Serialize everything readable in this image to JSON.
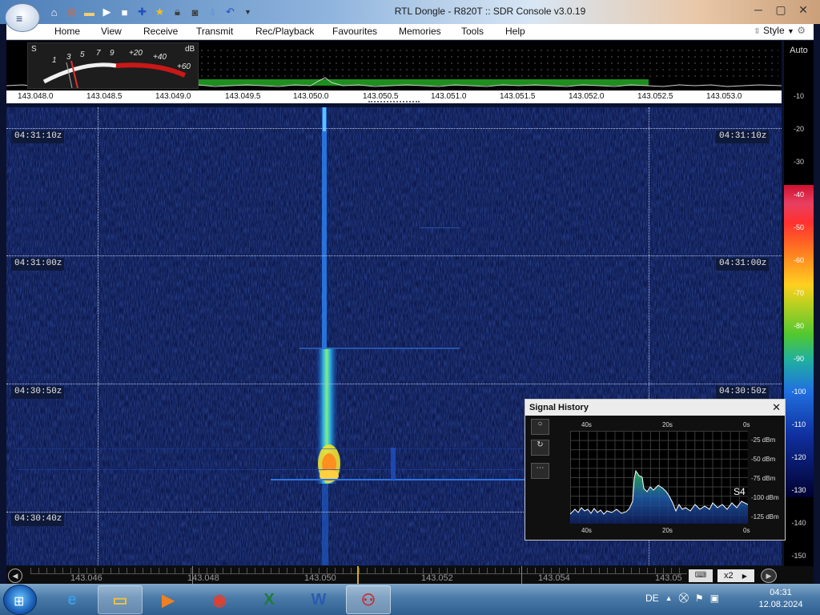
{
  "window": {
    "title": "RTL Dongle - R820T :: SDR Console v3.0.19",
    "minimize_glyph": "─",
    "maximize_glyph": "▢",
    "close_glyph": "✕",
    "orb_icon": "≡"
  },
  "quick_access": [
    "home-icon",
    "lifebuoy-icon",
    "folder-icon",
    "play-icon",
    "stop-icon",
    "plus-icon",
    "star-icon",
    "lock-icon",
    "camera-icon",
    "drop-icon",
    "undo-icon",
    "dropdown-icon"
  ],
  "menu": {
    "items": [
      "Home",
      "View",
      "Receive",
      "Transmit",
      "Rec/Playback",
      "Favourites",
      "Memories",
      "Tools",
      "Help"
    ],
    "style_label": "Style"
  },
  "smeter": {
    "s_label": "S",
    "db_label": "dB",
    "scale": [
      "1",
      "3",
      "5",
      "7",
      "9",
      "+20",
      "+40",
      "+60"
    ]
  },
  "freq_axis": {
    "ticks": [
      "143.048.0",
      "143.048.5",
      "143.049.0",
      "143.049.5",
      "143.050.0",
      "143.050.5",
      "143.051.0",
      "143.051.5",
      "143.052.0",
      "143.052.5",
      "143.053.0"
    ]
  },
  "waterfall": {
    "timestamps": [
      "04:31:10z",
      "04:31:00z",
      "04:30:50z",
      "04:30:40z"
    ]
  },
  "level_scale": {
    "auto_label": "Auto",
    "gray_levels": [
      "-10",
      "-20",
      "-30"
    ],
    "color_levels": [
      "-40",
      "-50",
      "-60",
      "-70",
      "-80",
      "-90",
      "-100",
      "-110",
      "-120",
      "-130"
    ],
    "bottom_levels": [
      "-140",
      "-150"
    ]
  },
  "bottom_bar": {
    "ticks": [
      "143.046",
      "143.048",
      "143.050",
      "143.052",
      "143.054",
      "143.05"
    ],
    "zoom_label": "x2"
  },
  "signal_history": {
    "title": "Signal History",
    "close_glyph": "✕",
    "time_labels": [
      "40s",
      "20s",
      "0s"
    ],
    "dbm_labels": [
      "-25 dBm",
      "-50 dBm",
      "-75 dBm",
      "-100 dBm",
      "-125 dBm"
    ],
    "s_reading": "S4",
    "button_glyphs": [
      "○",
      "↻",
      "⋯"
    ]
  },
  "taskbar": {
    "start_glyph": "⊞",
    "language": "DE",
    "time": "04:31",
    "date": "12.08.2024",
    "apps": [
      {
        "name": "ie",
        "glyph": "e",
        "color": "#3a9bea"
      },
      {
        "name": "explorer",
        "glyph": "▭",
        "color": "#f0c040"
      },
      {
        "name": "media-player",
        "glyph": "▶",
        "color": "#f08020"
      },
      {
        "name": "chrome",
        "glyph": "◉",
        "color": "#e04030"
      },
      {
        "name": "excel",
        "glyph": "X",
        "color": "#1e7a3a"
      },
      {
        "name": "word",
        "glyph": "W",
        "color": "#2a5bb0"
      },
      {
        "name": "sdr-console",
        "glyph": "⚇",
        "color": "#cc2b2b"
      }
    ]
  }
}
